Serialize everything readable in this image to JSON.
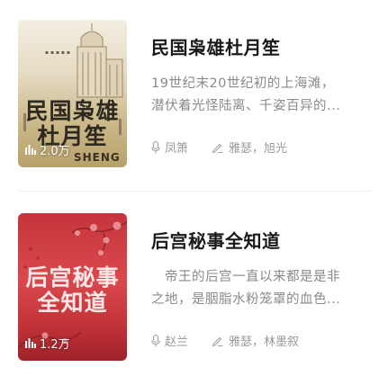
{
  "books": [
    {
      "title": "民国枭雄杜月笙",
      "cover_text": "民国枭雄杜月笙",
      "cover_text_line1": "民国枭雄",
      "cover_text_line2": "杜月笙",
      "cover_sub": "SHENG",
      "plays": "2.0万",
      "desc_line1": "19世纪末20世纪初的上海滩，",
      "desc_line2": "潜伏着光怪陆离、千姿百异的...",
      "author": "凤箫",
      "narrators": "雅瑟，旭光",
      "cover_style": "gold"
    },
    {
      "title": "后宫秘事全知道",
      "cover_text_line1": "后宫秘事",
      "cover_text_line2": "全知道",
      "plays": "1.2万",
      "desc_line1": "　帝王的后宫一直以来都是是非",
      "desc_line2": "之地，是胭脂水粉笼罩的血色...",
      "author": "赵兰",
      "narrators": "雅瑟，林墨叙",
      "cover_style": "red"
    }
  ],
  "icons": {
    "plays": "bar-chart-icon",
    "author": "microphone-icon",
    "narrators": "pen-icon"
  },
  "colors": {
    "title": "#1a1a1a",
    "description": "#8a8a8a",
    "meta": "#9a9a9a",
    "divider": "#eeeeee"
  }
}
